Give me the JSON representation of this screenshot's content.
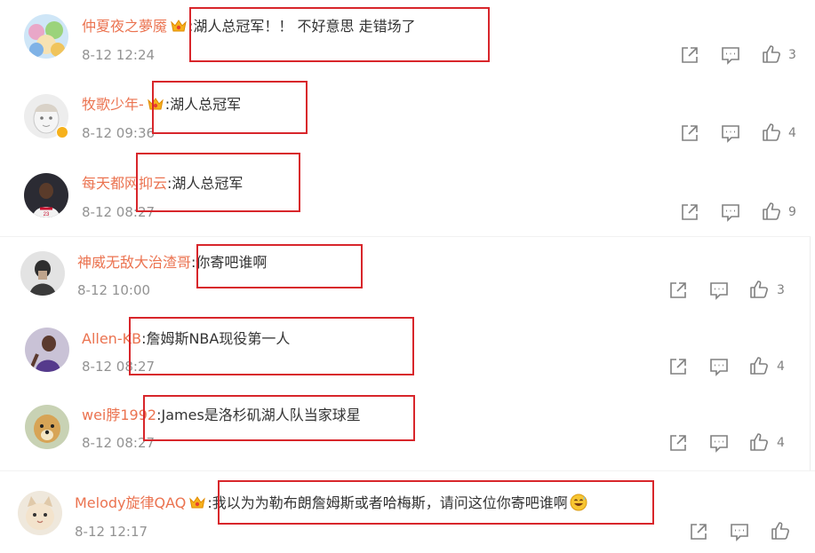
{
  "comments": [
    {
      "username": "仲夏夜之夢魇",
      "crown": true,
      "colon": ":",
      "text": "湖人总冠军！！ 不好意思 走错场了",
      "time": "8-12 12:24",
      "likes": "3",
      "avatar_icon": "anime-group-avatar"
    },
    {
      "username": "牧歌少年-",
      "crown": true,
      "colon": ":",
      "text": "湖人总冠军",
      "time": "8-12 09:36",
      "likes": "4",
      "avatar_icon": "cartoon-face-avatar",
      "verified": true
    },
    {
      "username": "每天都网抑云",
      "crown": false,
      "colon": ":",
      "text": "湖人总冠军",
      "time": "8-12 08:27",
      "likes": "9",
      "avatar_icon": "basketball-player-avatar"
    },
    {
      "username": "神威无敌大治渣哥",
      "crown": false,
      "colon": ":",
      "text": "你寄吧谁啊",
      "time": "8-12 10:00",
      "likes": "3",
      "avatar_icon": "portrait-avatar"
    },
    {
      "username": "Allen-KB",
      "crown": false,
      "colon": ":",
      "text": "詹姆斯NBA现役第一人",
      "time": "8-12 08:27",
      "likes": "4",
      "avatar_icon": "player-avatar"
    },
    {
      "username": "wei脖1992",
      "crown": false,
      "colon": ":",
      "text": "James是洛杉矶湖人队当家球星",
      "time": "8-12 08:27",
      "likes": "4",
      "avatar_icon": "dog-avatar"
    },
    {
      "username": "Melody旋律QAQ",
      "crown": true,
      "colon": ":",
      "text": "我以为为勒布朗詹姆斯或者哈梅斯，请问这位你寄吧谁啊",
      "time": "8-12 12:17",
      "likes": "",
      "avatar_icon": "cat-avatar",
      "emoji": "grinning-sweat-emoji"
    }
  ],
  "actions": {
    "share_icon": "share-icon",
    "comment_icon": "comment-icon",
    "like_icon": "thumbs-up-icon"
  },
  "colors": {
    "username": "#eb7350",
    "text": "#333333",
    "time": "#939393",
    "icon": "#808080",
    "highlight": "#d8262b",
    "crown": "#f6b11b"
  }
}
